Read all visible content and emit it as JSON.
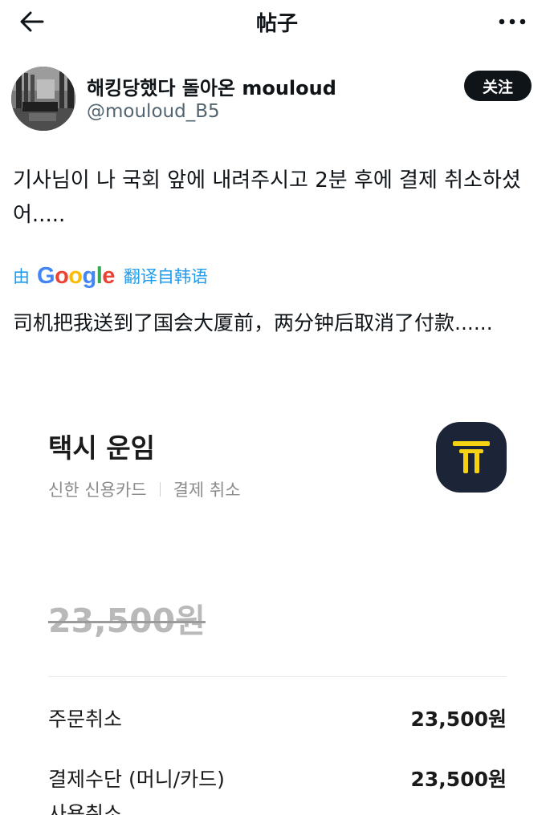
{
  "header": {
    "title": "帖子",
    "back_icon": "arrow-left-icon",
    "more_icon": "more-horizontal-icon"
  },
  "author": {
    "display_name": "해킹당했다 돌아온 mouloud",
    "handle": "@mouloud_B5",
    "follow_label": "关注"
  },
  "post": {
    "text": "기사님이 나 국회 앞에 내려주시고 2분 후에 결제 취소하셨어.....",
    "translate_prefix": "由",
    "translate_brand": "Google",
    "translate_suffix": "翻译自韩语",
    "translated_text": "司机把我送到了国会大厦前，两分钟后取消了付款......"
  },
  "receipt": {
    "title": "택시 운임",
    "card": "신한 신용카드",
    "status": "결제 취소",
    "original_price": "23,500원",
    "rows": [
      {
        "label": "주문취소",
        "value": "23,500원"
      },
      {
        "label": "결제수단 (머니/카드)",
        "value": "23,500원"
      },
      {
        "label": "사용취소",
        "value": ""
      }
    ]
  },
  "colors": {
    "link": "#1d9bf0",
    "follow_bg": "#0f1419",
    "taxi_icon_bg": "#1c2438",
    "taxi_icon_fg": "#f5d312"
  }
}
